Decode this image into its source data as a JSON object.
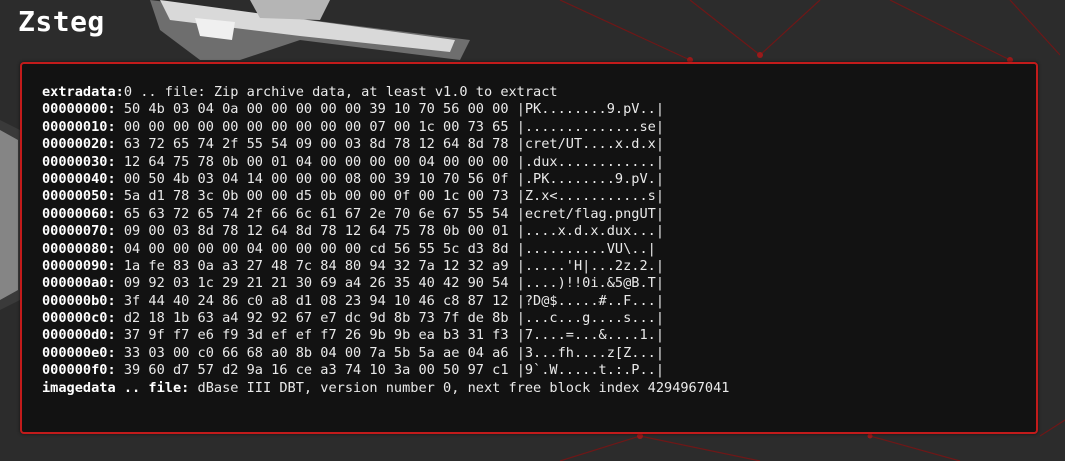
{
  "page": {
    "title": "Zsteg"
  },
  "output": {
    "extradata": {
      "label": "extradata:",
      "text": "0 .. file: Zip archive data, at least v1.0 to extract"
    },
    "hexdump": [
      {
        "offset": "00000000:",
        "bytes": " 50 4b 03 04 0a 00 00 00 00 00 39 10 70 56 00 00 |PK........9.pV..|"
      },
      {
        "offset": "00000010:",
        "bytes": " 00 00 00 00 00 00 00 00 00 00 07 00 1c 00 73 65 |..............se|"
      },
      {
        "offset": "00000020:",
        "bytes": " 63 72 65 74 2f 55 54 09 00 03 8d 78 12 64 8d 78 |cret/UT....x.d.x|"
      },
      {
        "offset": "00000030:",
        "bytes": " 12 64 75 78 0b 00 01 04 00 00 00 00 04 00 00 00 |.dux............|"
      },
      {
        "offset": "00000040:",
        "bytes": " 00 50 4b 03 04 14 00 00 00 08 00 39 10 70 56 0f |.PK........9.pV.|"
      },
      {
        "offset": "00000050:",
        "bytes": " 5a d1 78 3c 0b 00 00 d5 0b 00 00 0f 00 1c 00 73 |Z.x<...........s|"
      },
      {
        "offset": "00000060:",
        "bytes": " 65 63 72 65 74 2f 66 6c 61 67 2e 70 6e 67 55 54 |ecret/flag.pngUT|"
      },
      {
        "offset": "00000070:",
        "bytes": " 09 00 03 8d 78 12 64 8d 78 12 64 75 78 0b 00 01 |....x.d.x.dux...|"
      },
      {
        "offset": "00000080:",
        "bytes": " 04 00 00 00 00 04 00 00 00 00 cd 56 55 5c d3 8d |..........VU\\..|"
      },
      {
        "offset": "00000090:",
        "bytes": " 1a fe 83 0a a3 27 48 7c 84 80 94 32 7a 12 32 a9 |.....'H|...2z.2.|"
      },
      {
        "offset": "000000a0:",
        "bytes": " 09 92 03 1c 29 21 21 30 69 a4 26 35 40 42 90 54 |....)!!0i.&5@B.T|"
      },
      {
        "offset": "000000b0:",
        "bytes": " 3f 44 40 24 86 c0 a8 d1 08 23 94 10 46 c8 87 12 |?D@$.....#..F...|"
      },
      {
        "offset": "000000c0:",
        "bytes": " d2 18 1b 63 a4 92 92 67 e7 dc 9d 8b 73 7f de 8b |...c...g....s...|"
      },
      {
        "offset": "000000d0:",
        "bytes": " 37 9f f7 e6 f9 3d ef ef f7 26 9b 9b ea b3 31 f3 |7....=...&....1.|"
      },
      {
        "offset": "000000e0:",
        "bytes": " 33 03 00 c0 66 68 a0 8b 04 00 7a 5b 5a ae 04 a6 |3...fh....z[Z...|"
      },
      {
        "offset": "000000f0:",
        "bytes": " 39 60 d7 57 d2 9a 16 ce a3 74 10 3a 00 50 97 c1 |9`.W.....t.:.P..|"
      }
    ],
    "imagedata": {
      "label": "imagedata .. file:",
      "text": " dBase III DBT, version number 0, next free block index 4294967041"
    }
  },
  "colors": {
    "background": "#2b2b2b",
    "panel": "#121212",
    "accent_border": "#c21b1b",
    "text": "#eaeaea"
  }
}
